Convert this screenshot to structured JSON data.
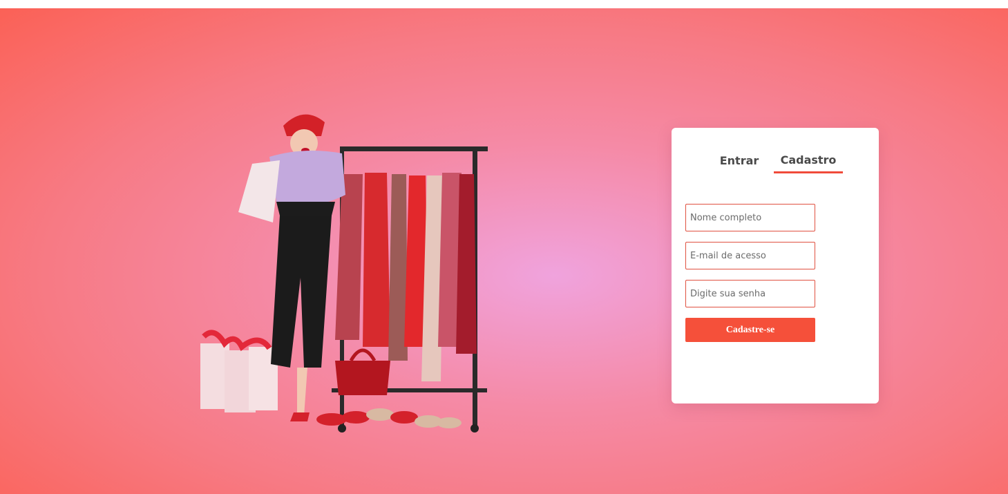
{
  "illustration": {
    "icon": "shopping-woman-with-clothing-rack"
  },
  "auth": {
    "tabs": {
      "login_label": "Entrar",
      "signup_label": "Cadastro",
      "active": "Cadastro"
    },
    "form": {
      "name_placeholder": "Nome completo",
      "email_placeholder": "E-mail de acesso",
      "password_placeholder": "Digite sua senha",
      "submit_label": "Cadastre-se"
    }
  },
  "colors": {
    "accent": "#f5503a",
    "background_center": "#f0a3dd",
    "background_edge": "#fb6156",
    "tab_text": "#4a4a4a"
  }
}
